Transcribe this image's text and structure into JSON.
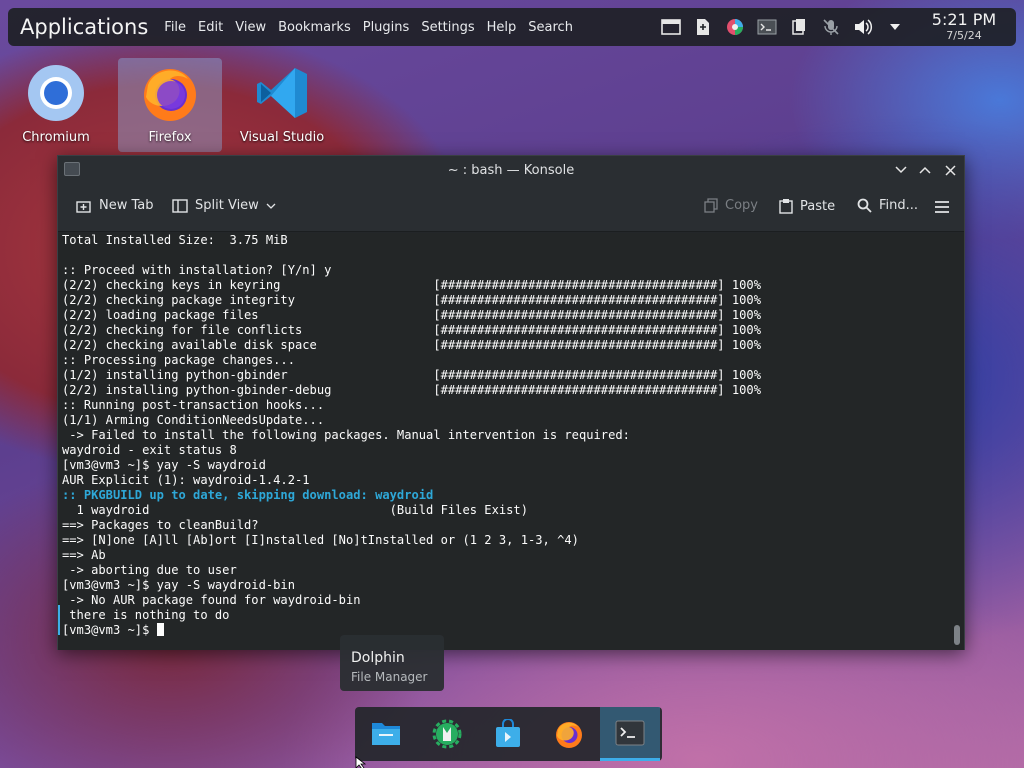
{
  "top_panel": {
    "launcher_label": "Applications",
    "menu": [
      "File",
      "Edit",
      "View",
      "Bookmarks",
      "Plugins",
      "Settings",
      "Help",
      "Search"
    ],
    "tray_icons": [
      "window-icon",
      "document-icon",
      "color-picker-icon",
      "terminal-icon",
      "clipboard-icon",
      "mic-muted-icon",
      "volume-icon",
      "chevron-down-icon"
    ],
    "clock": {
      "time": "5:21 PM",
      "date": "7/5/24"
    }
  },
  "desktop_icons": [
    {
      "label": "Chromium",
      "icon": "chromium-icon"
    },
    {
      "label": "Firefox",
      "icon": "firefox-icon",
      "selected": true
    },
    {
      "label": "Visual Studio Code",
      "icon": "vscode-icon"
    }
  ],
  "konsole": {
    "title": "~ : bash — Konsole",
    "toolbar": {
      "new_tab": "New Tab",
      "split_view": "Split View",
      "copy": "Copy",
      "paste": "Paste",
      "find": "Find..."
    },
    "lines": [
      "Total Installed Size:  3.75 MiB",
      "",
      ":: Proceed with installation? [Y/n] y",
      "(2/2) checking keys in keyring                     [######################################] 100%",
      "(2/2) checking package integrity                   [######################################] 100%",
      "(2/2) loading package files                        [######################################] 100%",
      "(2/2) checking for file conflicts                  [######################################] 100%",
      "(2/2) checking available disk space                [######################################] 100%",
      ":: Processing package changes...",
      "(1/2) installing python-gbinder                    [######################################] 100%",
      "(2/2) installing python-gbinder-debug              [######################################] 100%",
      ":: Running post-transaction hooks...",
      "(1/1) Arming ConditionNeedsUpdate...",
      " -> Failed to install the following packages. Manual intervention is required:",
      "waydroid - exit status 8",
      "[vm3@vm3 ~]$ yay -S waydroid",
      "AUR Explicit (1): waydroid-1.4.2-1",
      ":: PKGBUILD up to date, skipping download: waydroid",
      "  1 waydroid                                 (Build Files Exist)",
      "==> Packages to cleanBuild?",
      "==> [N]one [A]ll [Ab]ort [I]nstalled [No]tInstalled or (1 2 3, 1-3, ^4)",
      "==> Ab",
      " -> aborting due to user",
      "[vm3@vm3 ~]$ yay -S waydroid-bin",
      " -> No AUR package found for waydroid-bin",
      " there is nothing to do",
      "[vm3@vm3 ~]$ "
    ],
    "highlight_line_index": 17,
    "highlight_prefix": ":: ",
    "highlight_text": "PKGBUILD up to date, skipping download: waydroid"
  },
  "tooltip": {
    "title": "Dolphin",
    "subtitle": "File Manager"
  },
  "dock": [
    {
      "name": "dolphin",
      "icon": "folder-icon"
    },
    {
      "name": "discover-settings",
      "icon": "wrench-gear-icon"
    },
    {
      "name": "discover",
      "icon": "shopping-bag-icon"
    },
    {
      "name": "firefox",
      "icon": "firefox-icon"
    },
    {
      "name": "konsole",
      "icon": "terminal-icon",
      "active": true
    }
  ],
  "colors": {
    "accent": "#3daee9",
    "terminal_bg": "#232627",
    "highlight": "#2ea8d8"
  }
}
